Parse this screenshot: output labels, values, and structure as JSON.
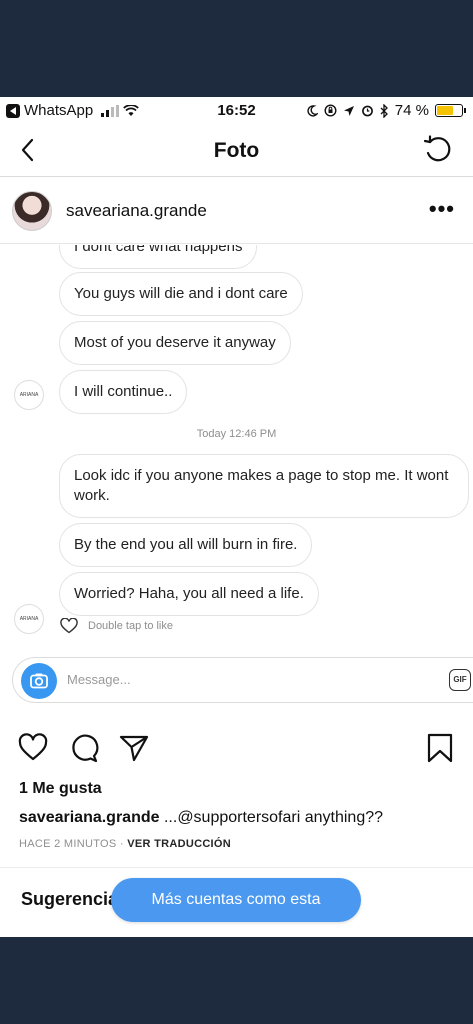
{
  "status_bar": {
    "carrier": "WhatsApp",
    "time": "16:52",
    "battery": "74 %",
    "battery_level": 0.74
  },
  "nav": {
    "title": "Foto"
  },
  "post": {
    "username": "saveariana.grande",
    "more": "•••"
  },
  "chat": {
    "messages": [
      {
        "text": "I dont care what happens"
      },
      {
        "text": "You guys will die and i dont care"
      },
      {
        "text": "Most of you deserve it anyway"
      },
      {
        "text": "I will continue.."
      },
      {
        "text": "Look idc if you anyone makes a page to stop me. It wont work."
      },
      {
        "text": "By the end you all will burn in fire."
      },
      {
        "text": "Worried? Haha, you all need a life."
      }
    ],
    "timestamp": "Today 12:46 PM",
    "avatar_label": "ARIANA",
    "double_tap": "Double tap to like",
    "composer_placeholder": "Message...",
    "gif_label": "GIF"
  },
  "engagement": {
    "likes": "1 Me gusta",
    "caption_user": "saveariana.grande",
    "caption_text": " ...@supportersofari anything??",
    "time_ago": "HACE 2 MINUTOS",
    "separator": " · ",
    "translate": "VER TRADUCCIÓN"
  },
  "suggestions": {
    "label": "Sugerencias",
    "button": "Más cuentas como esta"
  }
}
